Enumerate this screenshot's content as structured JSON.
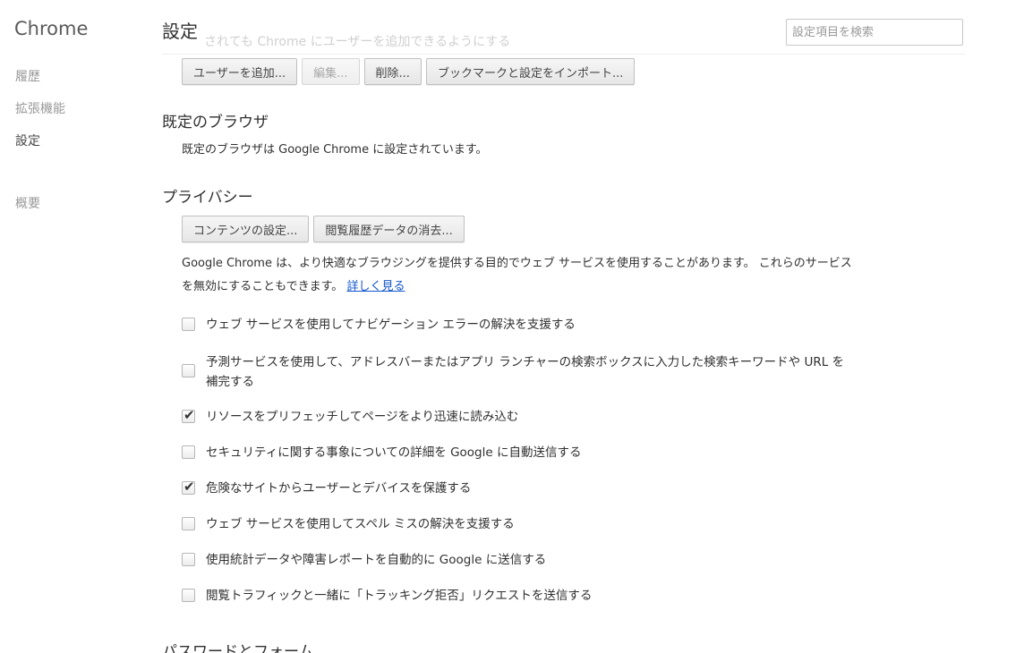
{
  "sidebar": {
    "brand": "Chrome",
    "items": [
      {
        "label": "履歴"
      },
      {
        "label": "拡張機能"
      },
      {
        "label": "設定"
      },
      {
        "label": "概要"
      }
    ]
  },
  "header": {
    "title": "設定",
    "ghost_text": "されても Chrome にユーザーを追加できるようにする",
    "search_placeholder": "設定項目を検索"
  },
  "users": {
    "buttons": {
      "add": "ユーザーを追加...",
      "edit": "編集...",
      "delete": "削除...",
      "import": "ブックマークと設定をインポート..."
    }
  },
  "default_browser": {
    "heading": "既定のブラウザ",
    "text": "既定のブラウザは Google Chrome に設定されています。"
  },
  "privacy": {
    "heading": "プライバシー",
    "buttons": {
      "content_settings": "コンテンツの設定...",
      "clear_browsing": "閲覧履歴データの消去..."
    },
    "description": "Google Chrome は、より快適なブラウジングを提供する目的でウェブ サービスを使用することがあります。 これらのサービスを無効にすることもできます。",
    "learn_more": "詳しく見る",
    "options": [
      {
        "label": "ウェブ サービスを使用してナビゲーション エラーの解決を支援する",
        "checked": false
      },
      {
        "label": "予測サービスを使用して、アドレスバーまたはアプリ ランチャーの検索ボックスに入力した検索キーワードや URL を補完する",
        "checked": false
      },
      {
        "label": "リソースをプリフェッチしてページをより迅速に読み込む",
        "checked": true
      },
      {
        "label": "セキュリティに関する事象についての詳細を Google に自動送信する",
        "checked": false
      },
      {
        "label": "危険なサイトからユーザーとデバイスを保護する",
        "checked": true
      },
      {
        "label": "ウェブ サービスを使用してスペル ミスの解決を支援する",
        "checked": false
      },
      {
        "label": "使用統計データや障害レポートを自動的に Google に送信する",
        "checked": false
      },
      {
        "label": "閲覧トラフィックと一緒に「トラッキング拒否」リクエストを送信する",
        "checked": false
      }
    ]
  },
  "passwords": {
    "heading": "パスワードとフォーム"
  }
}
